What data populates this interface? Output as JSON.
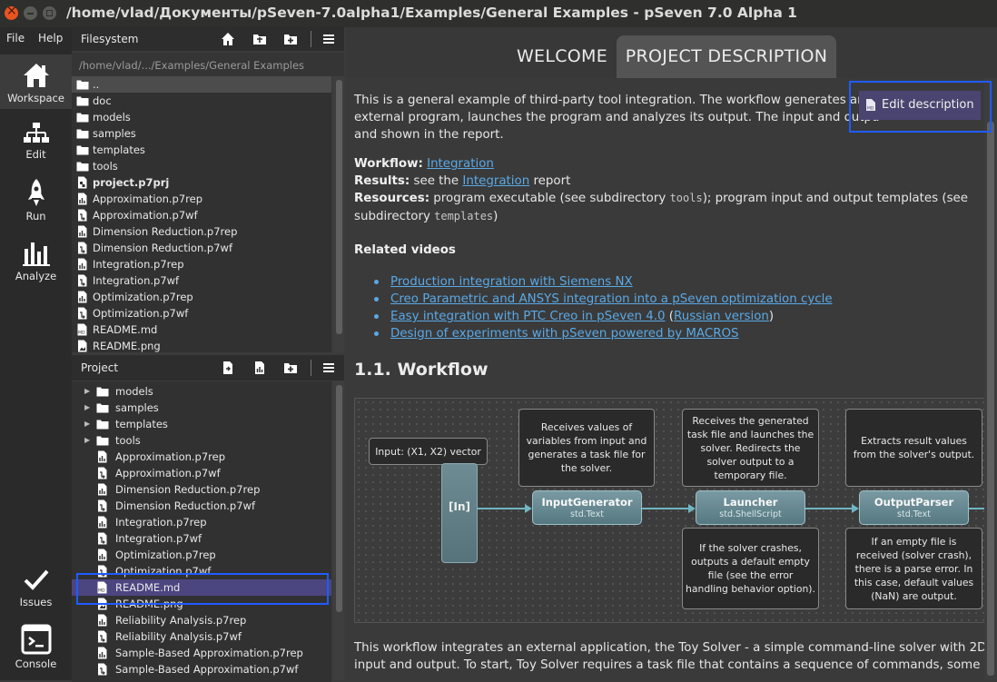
{
  "window": {
    "title": "/home/vlad/Документы/pSeven-7.0alpha1/Examples/General Examples - pSeven 7.0 Alpha 1"
  },
  "menu": {
    "file": "File",
    "help": "Help"
  },
  "activity": {
    "workspace": "Workspace",
    "edit": "Edit",
    "run": "Run",
    "analyze": "Analyze",
    "issues": "Issues",
    "console": "Console"
  },
  "filesystem": {
    "title": "Filesystem",
    "path": "/home/vlad/.../Examples/General Examples",
    "items": [
      {
        "name": "..",
        "type": "folder"
      },
      {
        "name": "doc",
        "type": "folder"
      },
      {
        "name": "models",
        "type": "folder"
      },
      {
        "name": "samples",
        "type": "folder"
      },
      {
        "name": "templates",
        "type": "folder"
      },
      {
        "name": "tools",
        "type": "folder"
      },
      {
        "name": "project.p7prj",
        "type": "project"
      },
      {
        "name": "Approximation.p7rep",
        "type": "report"
      },
      {
        "name": "Approximation.p7wf",
        "type": "workflow"
      },
      {
        "name": "Dimension Reduction.p7rep",
        "type": "report"
      },
      {
        "name": "Dimension Reduction.p7wf",
        "type": "workflow"
      },
      {
        "name": "Integration.p7rep",
        "type": "report"
      },
      {
        "name": "Integration.p7wf",
        "type": "workflow"
      },
      {
        "name": "Optimization.p7rep",
        "type": "report"
      },
      {
        "name": "Optimization.p7wf",
        "type": "workflow"
      },
      {
        "name": "README.md",
        "type": "md"
      },
      {
        "name": "README.png",
        "type": "image"
      }
    ]
  },
  "project": {
    "title": "Project",
    "items": [
      {
        "name": "models",
        "type": "folder"
      },
      {
        "name": "samples",
        "type": "folder"
      },
      {
        "name": "templates",
        "type": "folder"
      },
      {
        "name": "tools",
        "type": "folder"
      },
      {
        "name": "Approximation.p7rep",
        "type": "report"
      },
      {
        "name": "Approximation.p7wf",
        "type": "workflow"
      },
      {
        "name": "Dimension Reduction.p7rep",
        "type": "report"
      },
      {
        "name": "Dimension Reduction.p7wf",
        "type": "workflow"
      },
      {
        "name": "Integration.p7rep",
        "type": "report"
      },
      {
        "name": "Integration.p7wf",
        "type": "workflow"
      },
      {
        "name": "Optimization.p7rep",
        "type": "report"
      },
      {
        "name": "Optimization.p7wf",
        "type": "workflow"
      },
      {
        "name": "README.md",
        "type": "md"
      },
      {
        "name": "README.png",
        "type": "image"
      },
      {
        "name": "Reliability Analysis.p7rep",
        "type": "report"
      },
      {
        "name": "Reliability Analysis.p7wf",
        "type": "workflow"
      },
      {
        "name": "Sample-Based Approximation.p7rep",
        "type": "report"
      },
      {
        "name": "Sample-Based Approximation.p7wf",
        "type": "workflow"
      }
    ]
  },
  "tabs": {
    "welcome": "WELCOME",
    "project_description": "PROJECT DESCRIPTION"
  },
  "edit_description": "Edit description",
  "doc": {
    "intro1": "This is a general example of third-party tool integration. The workflow generates an in",
    "intro2": "external program, launches the program and analyzes its output. The input and outpu",
    "intro3": "and shown in the report.",
    "workflow_label": "Workflow:",
    "workflow_link": "Integration",
    "results_label": "Results:",
    "results_pre": " see the ",
    "results_link": "Integration",
    "results_post": " report",
    "resources_label": "Resources:",
    "resources_text1": " program executable (see subdirectory ",
    "resources_code1": "tools",
    "resources_text2": "); program input and output templates (see",
    "resources_text3": "subdirectory ",
    "resources_code2": "templates",
    "resources_text4": ")",
    "related_videos": "Related videos",
    "videos": [
      "Production integration with Siemens NX",
      "Creo Parametric and ANSYS integration into a pSeven optimization cycle",
      "Easy integration with PTC Creo in pSeven 4.0",
      "Design of experiments with pSeven powered by MACROS"
    ],
    "russian_link": "Russian version",
    "paren_open": " (",
    "paren_close": ")",
    "heading": "1.1. Workflow",
    "bottom1": "This workflow integrates an external application, the Toy Solver - a simple command-line solver with 2D",
    "bottom2": "input and output. To start, Toy Solver requires a task file that contains a sequence of commands, some"
  },
  "diagram": {
    "input_note": "Input: (X1, X2) vector",
    "in_port": "[In]",
    "note_generator": "Receives values of variables from input and generates a task file for the solver.",
    "note_launcher": "Receives the generated task file and launches the solver. Redirects the solver output to a temporary file.",
    "note_parser": "Extracts result values from the solver's output.",
    "note_crash": "If the solver crashes, outputs a default empty file (see the error handling behavior option).",
    "note_empty": "If an empty file is received (solver crash), there is a parse error. In this case, default values (NaN) are output.",
    "blocks": [
      {
        "name": "InputGenerator",
        "type": "std.Text"
      },
      {
        "name": "Launcher",
        "type": "std.ShellScript"
      },
      {
        "name": "OutputParser",
        "type": "std.Text"
      }
    ]
  }
}
